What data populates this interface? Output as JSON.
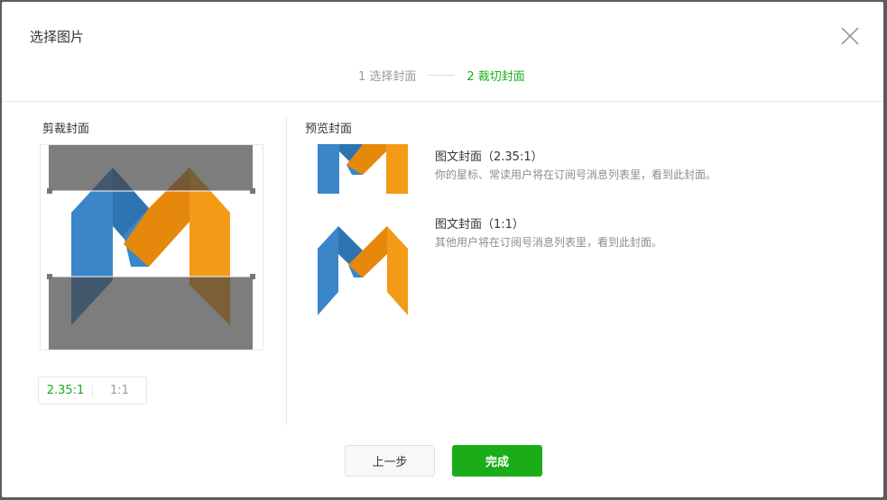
{
  "dialog": {
    "title": "选择图片",
    "close_icon": "close-icon"
  },
  "steps": [
    {
      "label": "1 选择封面",
      "active": false
    },
    {
      "label": "2 裁切封面",
      "active": true
    }
  ],
  "crop": {
    "label": "剪裁封面",
    "ratio_options": [
      {
        "label": "2.35:1",
        "active": true
      },
      {
        "label": "1:1",
        "active": false
      }
    ]
  },
  "preview": {
    "label": "预览封面",
    "items": [
      {
        "title": "图文封面（2.35:1）",
        "desc": "你的星标、常读用户将在订阅号消息列表里，看到此封面。"
      },
      {
        "title": "图文封面（1:1）",
        "desc": "其他用户将在订阅号消息列表里，看到此封面。"
      }
    ]
  },
  "buttons": {
    "prev": "上一步",
    "done": "完成"
  },
  "colors": {
    "accent": "#1aad19",
    "logo_blue": "#3a86c8",
    "logo_orange": "#f39a16"
  }
}
